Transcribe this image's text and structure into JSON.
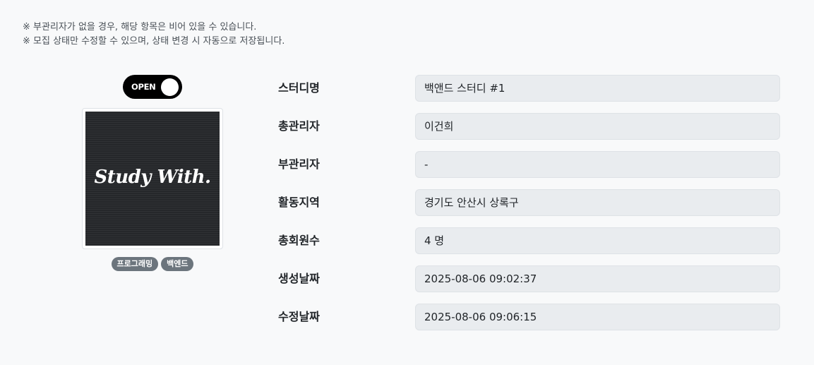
{
  "notes": [
    "※ 부관리자가 없을 경우, 해당 항목은 비어 있을 수 있습니다.",
    "※ 모집 상태만 수정할 수 있으며, 상태 변경 시 자동으로 저장됩니다."
  ],
  "recruit_toggle": {
    "label": "OPEN",
    "state": "on"
  },
  "thumbnail": {
    "text": "Study With."
  },
  "tags": [
    "프로그래밍",
    "백엔드"
  ],
  "info": [
    {
      "label": "스터디명",
      "value": "백앤드 스터디 #1"
    },
    {
      "label": "총관리자",
      "value": "이건희"
    },
    {
      "label": "부관리자",
      "value": "-"
    },
    {
      "label": "활동지역",
      "value": "경기도 안산시 상록구"
    },
    {
      "label": "총회원수",
      "value": "4 명"
    },
    {
      "label": "생성날짜",
      "value": "2025-08-06 09:02:37"
    },
    {
      "label": "수정날짜",
      "value": "2025-08-06 09:06:15"
    }
  ],
  "colors": {
    "page_background": "#f8f9fa",
    "field_background": "#e9ecef",
    "toggle_background": "#000000",
    "tag_background": "#6c757d"
  }
}
